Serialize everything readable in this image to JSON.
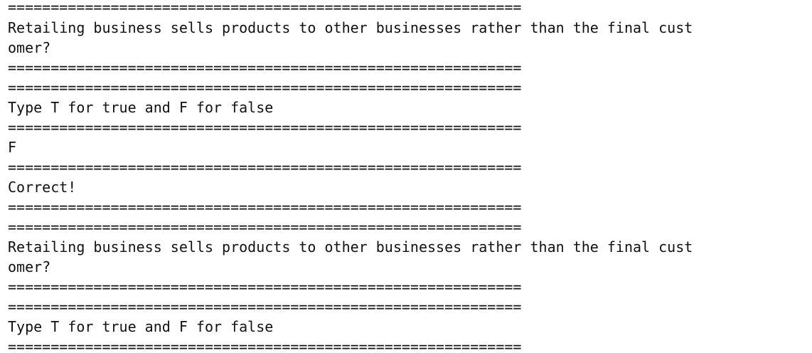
{
  "console": {
    "lines": [
      {
        "kind": "separator",
        "text": "============================================================"
      },
      {
        "kind": "text",
        "text": "Retailing business sells products to other businesses rather than the final cust"
      },
      {
        "kind": "text",
        "text": "omer?"
      },
      {
        "kind": "separator",
        "text": "============================================================"
      },
      {
        "kind": "separator",
        "text": "============================================================"
      },
      {
        "kind": "text",
        "text": "Type T for true and F for false"
      },
      {
        "kind": "separator",
        "text": "============================================================"
      },
      {
        "kind": "text",
        "text": "F"
      },
      {
        "kind": "separator",
        "text": "============================================================"
      },
      {
        "kind": "text",
        "text": "Correct!"
      },
      {
        "kind": "separator",
        "text": "============================================================"
      },
      {
        "kind": "separator",
        "text": "============================================================"
      },
      {
        "kind": "text",
        "text": "Retailing business sells products to other businesses rather than the final cust"
      },
      {
        "kind": "text",
        "text": "omer?"
      },
      {
        "kind": "separator",
        "text": "============================================================"
      },
      {
        "kind": "separator",
        "text": "============================================================"
      },
      {
        "kind": "text",
        "text": "Type T for true and F for false"
      },
      {
        "kind": "separator",
        "text": "============================================================"
      }
    ]
  }
}
